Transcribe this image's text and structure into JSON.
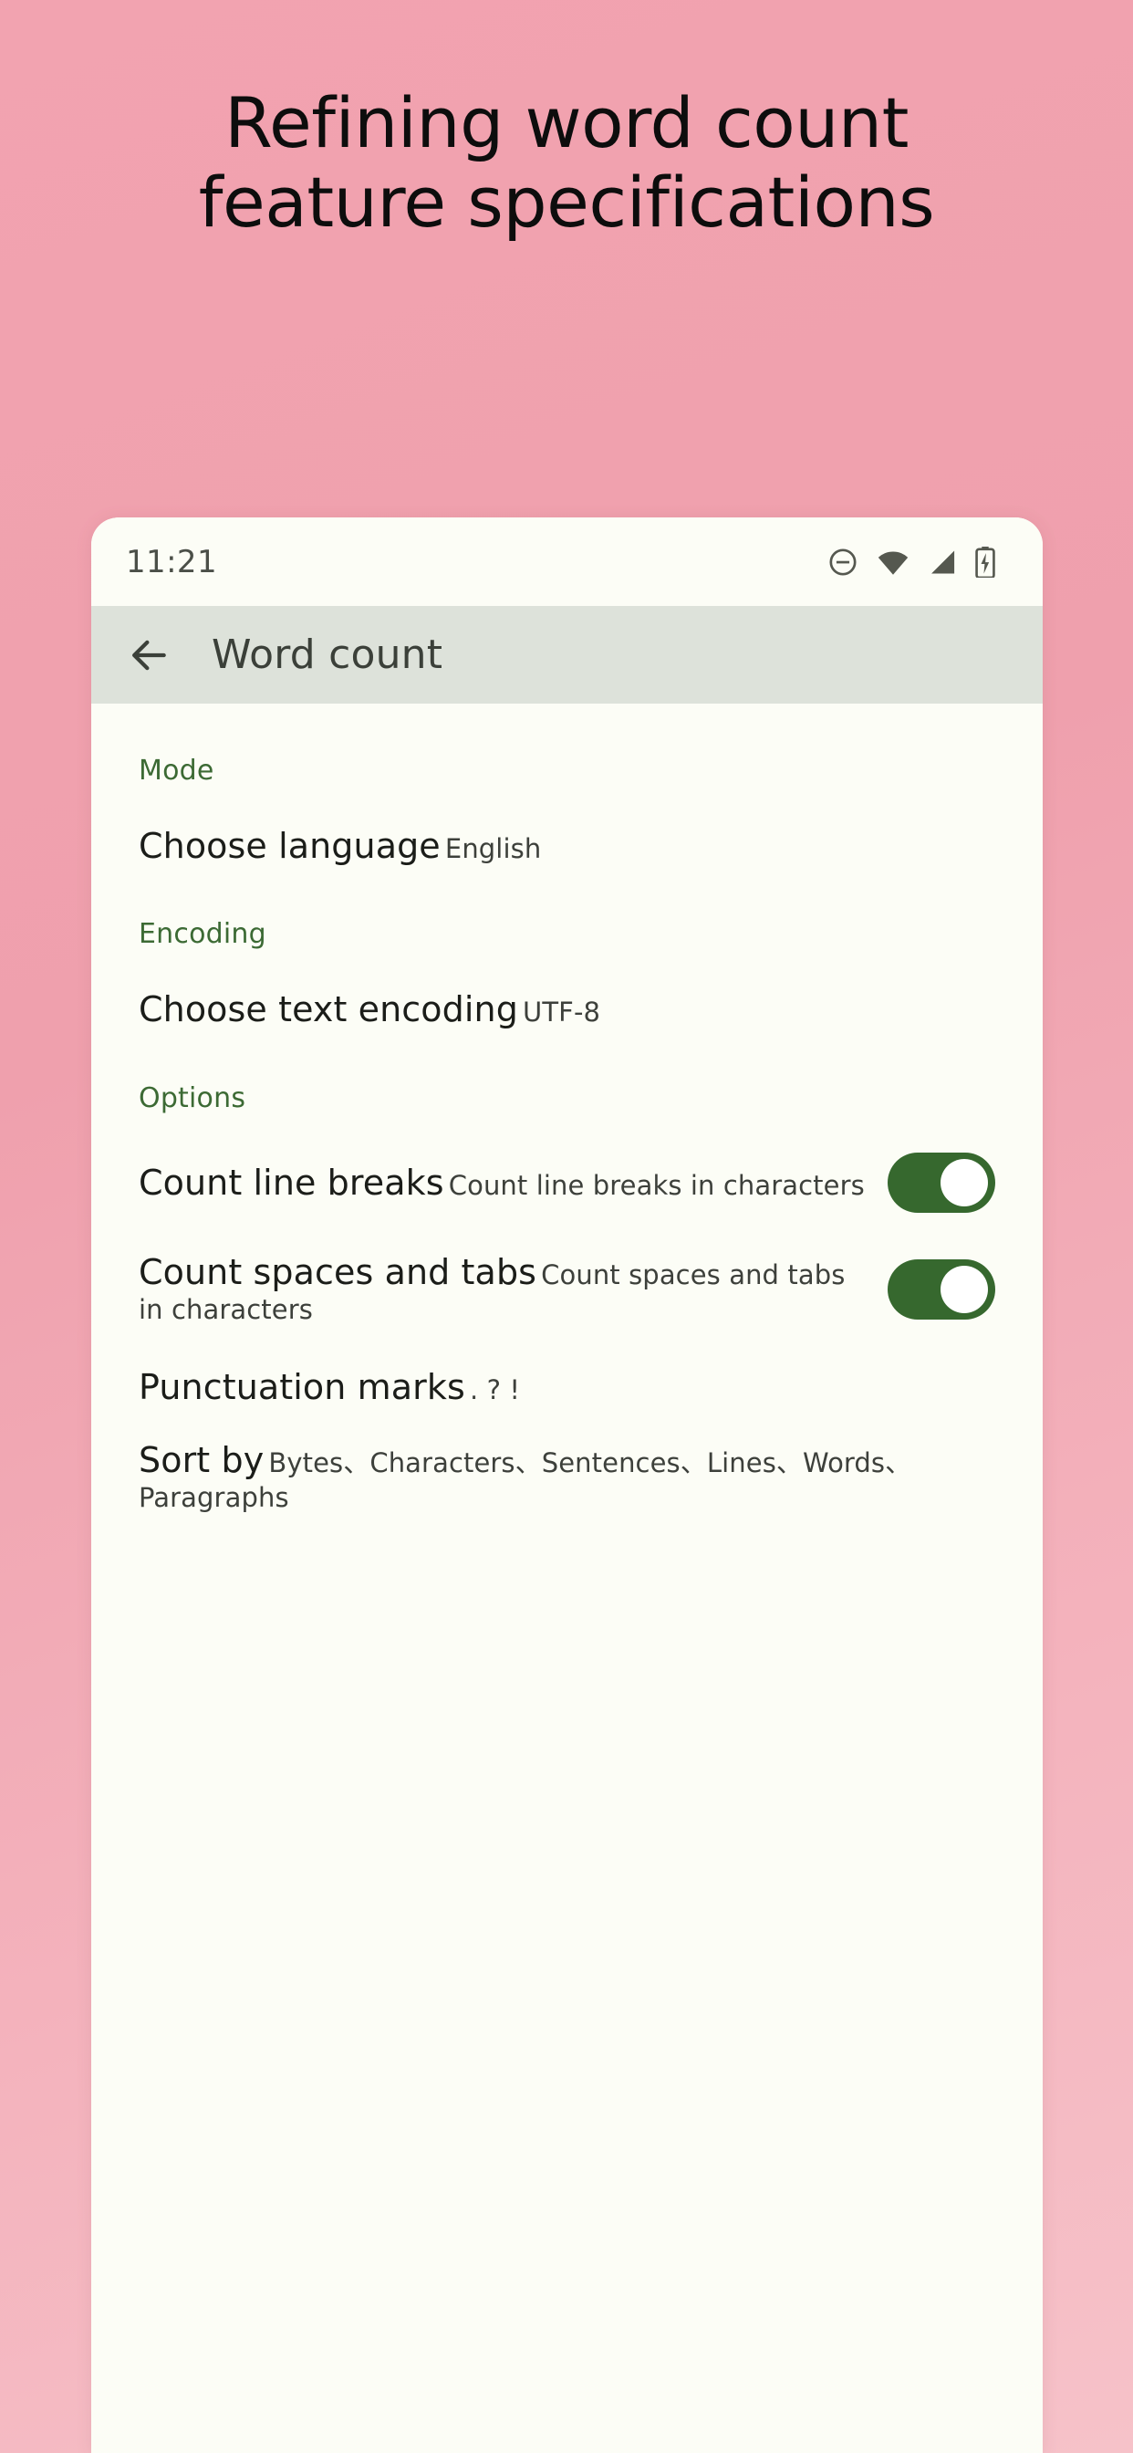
{
  "promo": {
    "line1": "Refining word count",
    "line2": "feature specifications"
  },
  "theme": {
    "background_pink": "#f0a0ad",
    "card_background": "#fcfdf6",
    "appbar_background": "#dde2da",
    "section_header_green": "#3c6a34",
    "toggle_on_green": "#36682e",
    "toggle_knob": "#ffffff",
    "title_text": "#1b1d19",
    "subtitle_text": "#3d403b"
  },
  "statusbar": {
    "time": "11:21",
    "icons": [
      {
        "name": "do-not-disturb-icon"
      },
      {
        "name": "wifi-icon"
      },
      {
        "name": "cellular-signal-icon"
      },
      {
        "name": "battery-charging-icon"
      }
    ]
  },
  "appbar": {
    "back_label": "Back",
    "title": "Word count"
  },
  "sections": [
    {
      "header": "Mode",
      "items": [
        {
          "title": "Choose language",
          "subtitle": "English",
          "type": "choice"
        }
      ]
    },
    {
      "header": "Encoding",
      "items": [
        {
          "title": "Choose text encoding",
          "subtitle": "UTF-8",
          "type": "choice"
        }
      ]
    },
    {
      "header": "Options",
      "items": [
        {
          "title": "Count line breaks",
          "subtitle": "Count line breaks in characters",
          "type": "switch",
          "value": "on"
        },
        {
          "title": "Count spaces and tabs",
          "subtitle": "Count spaces and tabs in characters",
          "type": "switch",
          "value": "on"
        },
        {
          "title": "Punctuation marks",
          "subtitle": ". ? !",
          "type": "choice"
        },
        {
          "title": "Sort by",
          "subtitle": "Bytes、Characters、Sentences、Lines、Words、Paragraphs",
          "type": "choice"
        }
      ]
    }
  ]
}
